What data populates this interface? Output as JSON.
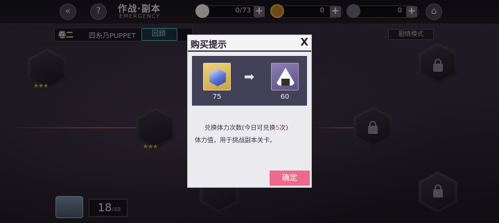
{
  "topbar": {
    "title": "作战·副本",
    "subtitle": "EMERGENCY",
    "resources": [
      {
        "icon": "onigiri-icon",
        "value": "0/73"
      },
      {
        "icon": "coin-icon",
        "value": "0"
      },
      {
        "icon": "token-icon",
        "value": "0"
      }
    ]
  },
  "chapter": {
    "number": "卷二",
    "name": "四糸乃PUPPET",
    "back_label": "回顾",
    "mode_label": "剧情模式"
  },
  "stage_counter": {
    "current": "18",
    "max": "/48"
  },
  "dialog": {
    "title": "购买提示",
    "close_label": "X",
    "cost": {
      "icon": "crystal-icon",
      "amount": "75"
    },
    "reward": {
      "icon": "onigiri-icon",
      "amount": "60"
    },
    "message_prefix": "兑换体力次数(今日可兑换",
    "message_highlight": "5",
    "message_suffix": "次)",
    "message_line2": "体力值，用于挑战副本关卡。",
    "confirm_label": "确定"
  },
  "colors": {
    "accent_pink": "#ec6a8b",
    "highlight": "#e5487a",
    "panel_dark": "#434157"
  }
}
